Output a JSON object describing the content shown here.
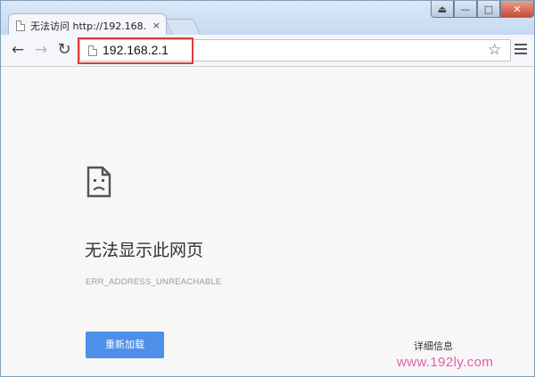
{
  "browser": {
    "tab": {
      "title": "无法访问 http://192.168.",
      "close_glyph": "×"
    },
    "window_controls": {
      "user_glyph": "⏏",
      "min_glyph": "—",
      "max_glyph": "□",
      "close_glyph": "✕"
    },
    "toolbar": {
      "back_glyph": "←",
      "forward_glyph": "→",
      "reload_glyph": "↻",
      "address": "192.168.2.1",
      "bookmark_glyph": "☆"
    }
  },
  "page": {
    "error_title": "无法显示此网页",
    "error_code": "ERR_ADDRESS_UNREACHABLE",
    "reload_button": "重新加载",
    "details_link": "详细信息"
  },
  "watermark": "www.192ly.com",
  "colors": {
    "reload_button_bg": "#4e8fe9",
    "highlight_border": "#e23a3a",
    "watermark": "#e45fa8"
  }
}
